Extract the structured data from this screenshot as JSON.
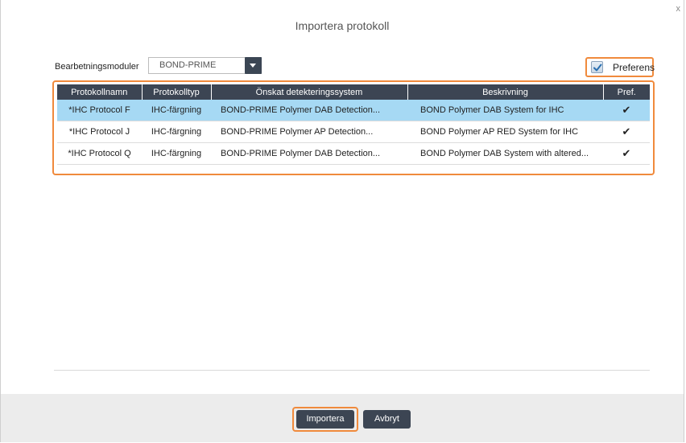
{
  "dialog": {
    "title": "Importera protokoll",
    "close_glyph": "x"
  },
  "filters": {
    "module_label": "Bearbetningsmoduler",
    "module_value": "BOND-PRIME",
    "preference_label": "Preferens",
    "preference_checked": true
  },
  "table": {
    "columns": [
      "Protokollnamn",
      "Protokolltyp",
      "Önskat detekteringssystem",
      "Beskrivning",
      "Pref."
    ],
    "rows": [
      {
        "name": "*IHC Protocol F",
        "type": "IHC-färgning",
        "system": "BOND-PRIME Polymer DAB Detection...",
        "description": "BOND Polymer DAB System for IHC",
        "pref": "✔",
        "selected": true
      },
      {
        "name": "*IHC Protocol J",
        "type": "IHC-färgning",
        "system": "BOND-PRIME Polymer AP Detection...",
        "description": "BOND Polymer AP RED System for IHC",
        "pref": "✔",
        "selected": false
      },
      {
        "name": "*IHC Protocol Q",
        "type": "IHC-färgning",
        "system": "BOND-PRIME Polymer DAB Detection...",
        "description": "BOND Polymer DAB System with altered...",
        "pref": "✔",
        "selected": false
      }
    ]
  },
  "buttons": {
    "import_label": "Importera",
    "cancel_label": "Avbryt"
  },
  "colors": {
    "highlight": "#f08a3c",
    "header_bg": "#3c4553",
    "selected_row": "#a6d9f4"
  }
}
